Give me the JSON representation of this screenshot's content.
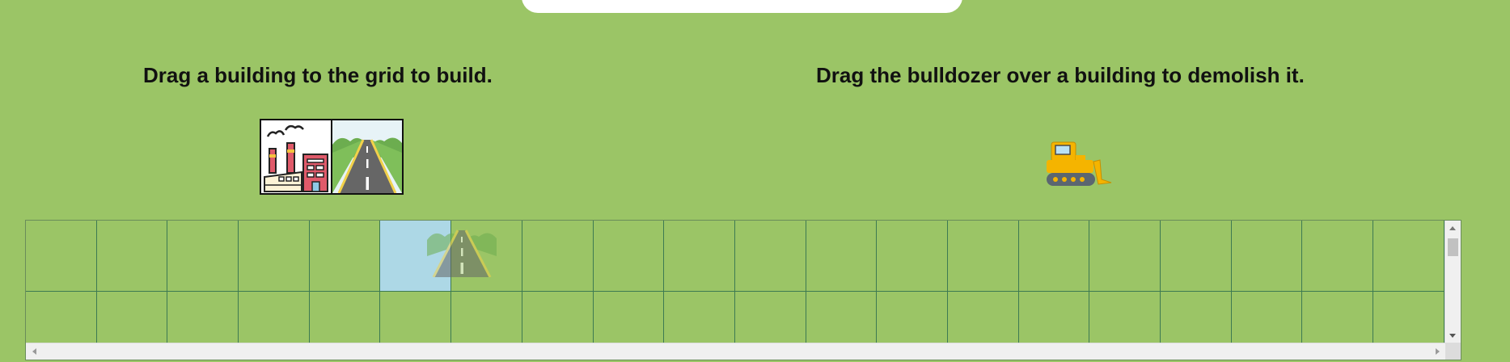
{
  "instructions": {
    "build": "Drag a building to the grid to build.",
    "demolish": "Drag the bulldozer over a building to demolish it."
  },
  "palette": {
    "items": [
      {
        "icon": "factory-icon"
      },
      {
        "icon": "road-icon"
      }
    ]
  },
  "tools": {
    "bulldozer_icon": "bulldozer-icon"
  },
  "grid": {
    "visible_columns": 20,
    "visible_rows": 2,
    "highlighted_cell": {
      "row": 1,
      "col": 6
    },
    "drag_preview": "road-icon"
  },
  "colors": {
    "background": "#9bc566",
    "grid_line": "#3d7a52",
    "highlight": "#add8e6",
    "bulldozer": "#f5b400"
  }
}
